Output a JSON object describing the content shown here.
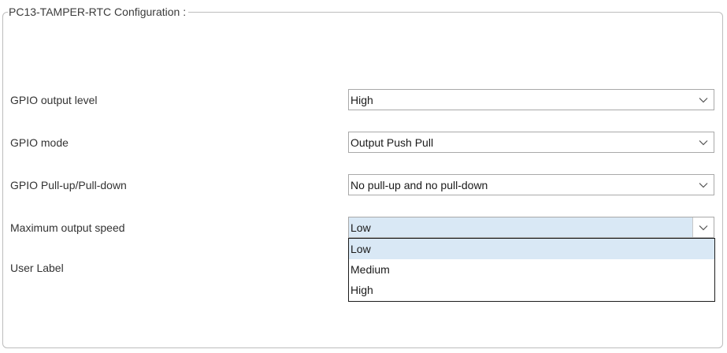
{
  "panel": {
    "title": "PC13-TAMPER-RTC Configuration :"
  },
  "fields": [
    {
      "label": "GPIO output level",
      "value": "High"
    },
    {
      "label": "GPIO mode",
      "value": "Output Push Pull"
    },
    {
      "label": "GPIO Pull-up/Pull-down",
      "value": "No pull-up and no pull-down"
    },
    {
      "label": "Maximum output speed",
      "value": "Low"
    },
    {
      "label": "User Label",
      "value": ""
    }
  ],
  "dropdown": {
    "open_for": "Maximum output speed",
    "selected": "Low",
    "options": [
      "Low",
      "Medium",
      "High"
    ]
  },
  "colors": {
    "selection_highlight": "#d9e8f5",
    "border": "#a9a9a9",
    "dropdown_border": "#1c1c1c"
  },
  "icons": {
    "select_arrow": "chevron-down-icon"
  }
}
